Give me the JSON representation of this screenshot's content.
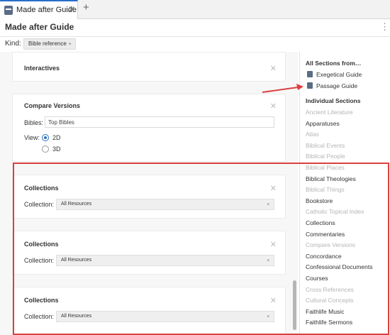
{
  "tab": {
    "title": "Made after Guide",
    "close": "✕",
    "new": "+"
  },
  "header": {
    "title": "Made after Guide",
    "menu": "⋮"
  },
  "kind": {
    "label": "Kind:",
    "value": "Bible reference",
    "chev": "▾"
  },
  "cards": {
    "interactives": {
      "title": "Interactives",
      "close": "✕"
    },
    "compare": {
      "title": "Compare Versions",
      "close": "✕",
      "bibles_label": "Bibles:",
      "bibles_value": "Top Bibles",
      "view_label": "View:",
      "options": [
        "2D",
        "3D"
      ],
      "selected": "2D"
    },
    "collections": [
      {
        "title": "Collections",
        "close": "✕",
        "label": "Collection:",
        "value": "All Resources",
        "chev": "▾"
      },
      {
        "title": "Collections",
        "close": "✕",
        "label": "Collection:",
        "value": "All Resources",
        "chev": "▾"
      },
      {
        "title": "Collections",
        "close": "✕",
        "label": "Collection:",
        "value": "All Resources",
        "chev": "▾"
      }
    ]
  },
  "sidebar": {
    "all_heading": "All Sections from…",
    "guides": [
      {
        "label": "Exegetical Guide",
        "icon": "guide-icon"
      },
      {
        "label": "Passage Guide",
        "icon": "guide-icon"
      }
    ],
    "individual_heading": "Individual Sections",
    "items": [
      {
        "label": "Ancient Literature",
        "enabled": false
      },
      {
        "label": "Apparatuses",
        "enabled": true
      },
      {
        "label": "Atlas",
        "enabled": false
      },
      {
        "label": "Biblical Events",
        "enabled": false
      },
      {
        "label": "Biblical People",
        "enabled": false
      },
      {
        "label": "Biblical Places",
        "enabled": false
      },
      {
        "label": "Biblical Theologies",
        "enabled": true
      },
      {
        "label": "Biblical Things",
        "enabled": false
      },
      {
        "label": "Bookstore",
        "enabled": true
      },
      {
        "label": "Catholic Topical Index",
        "enabled": false
      },
      {
        "label": "Collections",
        "enabled": true
      },
      {
        "label": "Commentaries",
        "enabled": true
      },
      {
        "label": "Compare Versions",
        "enabled": false
      },
      {
        "label": "Concordance",
        "enabled": true
      },
      {
        "label": "Confessional Documents",
        "enabled": true
      },
      {
        "label": "Courses",
        "enabled": true
      },
      {
        "label": "Cross References",
        "enabled": false
      },
      {
        "label": "Cultural Concepts",
        "enabled": false
      },
      {
        "label": "Faithlife Music",
        "enabled": true
      },
      {
        "label": "Faithlife Sermons",
        "enabled": true
      }
    ]
  },
  "colors": {
    "accent": "#2a6fc9",
    "highlight": "#d9413f"
  }
}
